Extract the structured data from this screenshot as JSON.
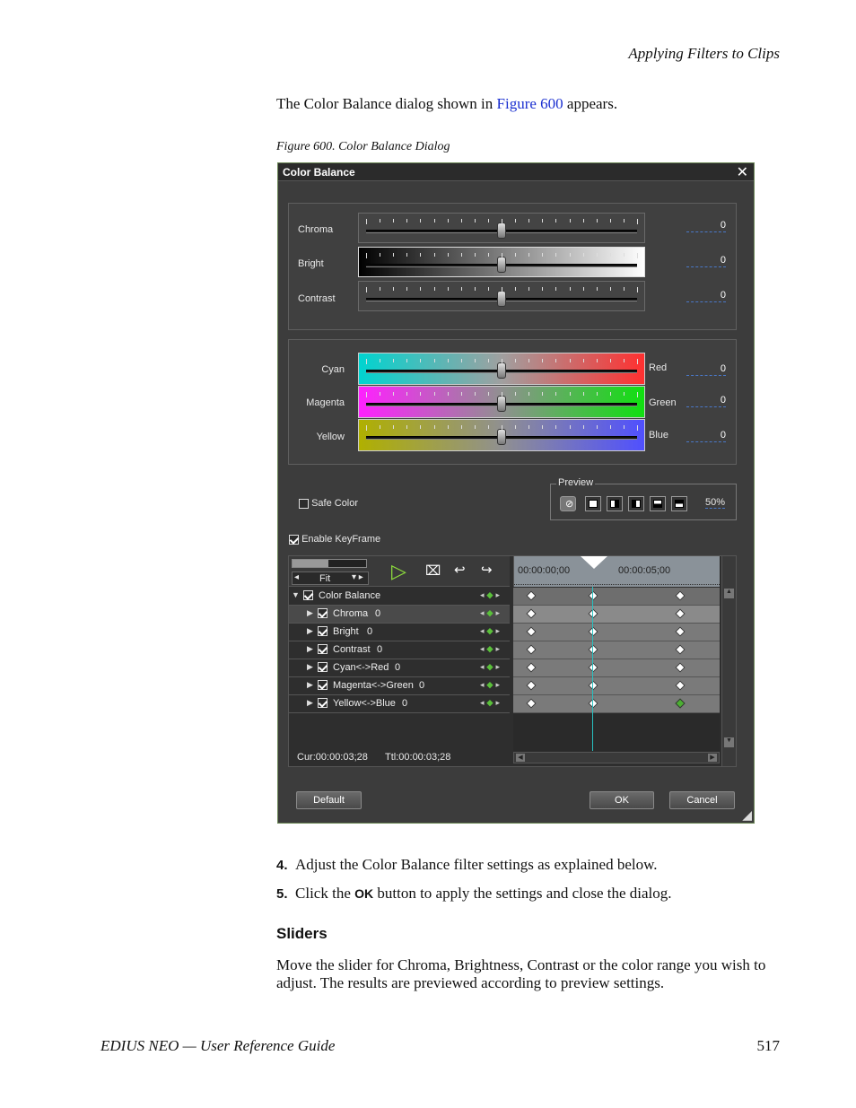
{
  "header": {
    "running_title": "Applying Filters to Clips"
  },
  "intro": {
    "before": "The Color Balance dialog shown in ",
    "link": "Figure 600",
    "after": " appears."
  },
  "caption": "Figure 600.  Color Balance Dialog",
  "dialog": {
    "title": "Color Balance",
    "close_glyph": "✕",
    "tone": [
      {
        "label": "Chroma",
        "value": "0",
        "position": 0.5
      },
      {
        "label": "Bright",
        "value": "0",
        "position": 0.5
      },
      {
        "label": "Contrast",
        "value": "0",
        "position": 0.5
      }
    ],
    "color": [
      {
        "left": "Cyan",
        "right": "Red",
        "value": "0",
        "position": 0.5
      },
      {
        "left": "Magenta",
        "right": "Green",
        "value": "0",
        "position": 0.5
      },
      {
        "left": "Yellow",
        "right": "Blue",
        "value": "0",
        "position": 0.5
      }
    ],
    "safe_color": "Safe Color",
    "preview": {
      "legend": "Preview",
      "zoom": "50%"
    },
    "enable_keyframe": "Enable KeyFrame",
    "timeline": {
      "fit": "Fit",
      "tc_start": "00:00:00;00",
      "tc_mid": "00:00:05;00",
      "tracks": [
        {
          "name": "Color Balance",
          "value": ""
        },
        {
          "name": "Chroma",
          "value": "0"
        },
        {
          "name": "Bright",
          "value": "0"
        },
        {
          "name": "Contrast",
          "value": "0"
        },
        {
          "name": "Cyan<->Red",
          "value": "0"
        },
        {
          "name": "Magenta<->Green",
          "value": "0"
        },
        {
          "name": "Yellow<->Blue",
          "value": "0"
        }
      ],
      "cur": "Cur:00:00:03;28",
      "ttl": "Ttl:00:00:03;28"
    },
    "buttons": {
      "default": "Default",
      "ok": "OK",
      "cancel": "Cancel"
    }
  },
  "steps": [
    {
      "num": "4.",
      "text": "Adjust the Color Balance filter settings as explained below."
    },
    {
      "num": "5.",
      "pre": "Click the ",
      "bold": "OK",
      "post": " button to apply the settings and close the dialog."
    }
  ],
  "section": "Sliders",
  "paragraph": "Move the slider for Chroma, Brightness, Contrast or the color range you wish to adjust. The results are previewed according to preview settings.",
  "footer": {
    "left": "EDIUS NEO  —  User Reference Guide",
    "page": "517"
  }
}
